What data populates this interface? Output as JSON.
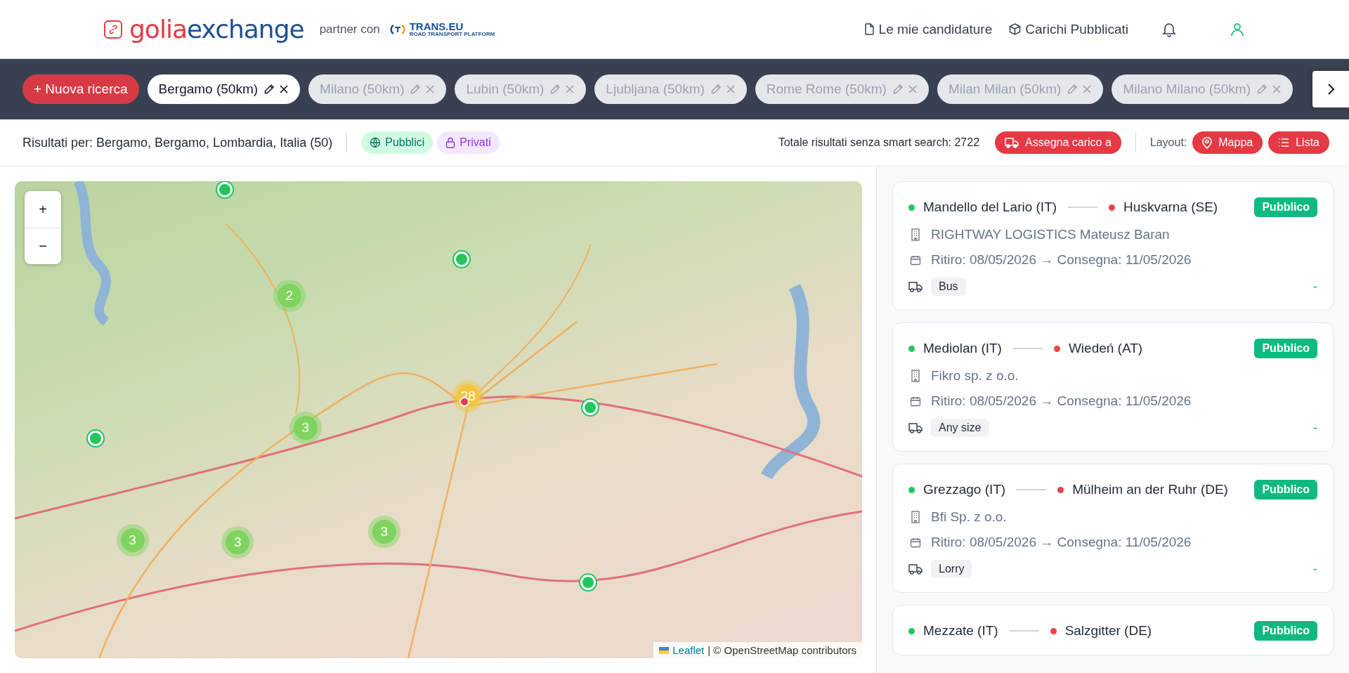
{
  "header": {
    "logo": {
      "first": "golia",
      "second": "exchange"
    },
    "partner_label": "partner con",
    "partner_logo": {
      "name": "TRANS.EU",
      "tagline": "ROAD TRANSPORT PLATFORM"
    },
    "nav": [
      {
        "label": "Le mie candidature",
        "kind": "applications"
      },
      {
        "label": "Carichi Pubblicati",
        "kind": "loads"
      }
    ]
  },
  "search_bar": {
    "new_search": "+ Nuova ricerca",
    "tabs": [
      {
        "label": "Bergamo (50km)",
        "selected": true
      },
      {
        "label": "Milano (50km)",
        "selected": false
      },
      {
        "label": "Lubin (50km)",
        "selected": false
      },
      {
        "label": "Ljubljana (50km)",
        "selected": false
      },
      {
        "label": "Rome Rome (50km)",
        "selected": false
      },
      {
        "label": "Milan Milan (50km)",
        "selected": false
      },
      {
        "label": "Milano Milano (50km)",
        "selected": false
      }
    ]
  },
  "results_bar": {
    "summary": "Risultati per: Bergamo, Bergamo, Lombardia, Italia (50)",
    "filters": [
      {
        "label": "Pubblici",
        "kind": "public"
      },
      {
        "label": "Privati",
        "kind": "private"
      }
    ],
    "total": "Totale risultati senza smart search: 2722",
    "assign_button": "Assegna carico a",
    "layout_label": "Layout:",
    "layout_buttons": [
      {
        "label": "Mappa",
        "kind": "map"
      },
      {
        "label": "Lista",
        "kind": "list"
      }
    ]
  },
  "map": {
    "zoom_in": "+",
    "zoom_out": "−",
    "markers": [
      {
        "kind": "pin"
      },
      {
        "kind": "pin"
      },
      {
        "kind": "cluster",
        "count": "2"
      },
      {
        "kind": "cluster_large",
        "count": "28"
      },
      {
        "kind": "center"
      },
      {
        "kind": "pin"
      },
      {
        "kind": "pin"
      },
      {
        "kind": "cluster",
        "count": "3"
      },
      {
        "kind": "cluster",
        "count": "3"
      },
      {
        "kind": "cluster",
        "count": "3"
      },
      {
        "kind": "cluster",
        "count": "3"
      },
      {
        "kind": "pin"
      }
    ],
    "attribution": {
      "link": "Leaflet",
      "text": "| © OpenStreetMap contributors"
    }
  },
  "cards": [
    {
      "origin": "Mandello del Lario (IT)",
      "destination": "Huskvarna (SE)",
      "badge": "Pubblico",
      "company": "RIGHTWAY LOGISTICS Mateusz Baran",
      "dates": "Ritiro: 08/05/2026 → Consegna: 11/05/2026",
      "vehicle": "Bus",
      "price": "-"
    },
    {
      "origin": "Mediolan (IT)",
      "destination": "Wiedeń (AT)",
      "badge": "Pubblico",
      "company": "Fikro sp. z o.o.",
      "dates": "Ritiro: 08/05/2026 → Consegna: 11/05/2026",
      "vehicle": "Any size",
      "price": "-"
    },
    {
      "origin": "Grezzago (IT)",
      "destination": "Mülheim an der Ruhr (DE)",
      "badge": "Pubblico",
      "company": "Bfi Sp. z o.o.",
      "dates": "Ritiro: 08/05/2026 → Consegna: 11/05/2026",
      "vehicle": "Lorry",
      "price": "-"
    },
    {
      "origin": "Mezzate (IT)",
      "destination": "Salzgitter (DE)",
      "badge": "Pubblico"
    }
  ]
}
